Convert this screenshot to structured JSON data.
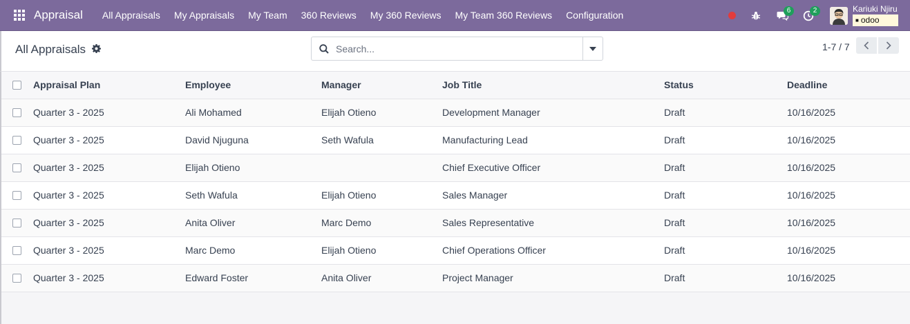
{
  "navbar": {
    "app_name": "Appraisal",
    "menu": [
      "All Appraisals",
      "My Appraisals",
      "My Team",
      "360 Reviews",
      "My 360 Reviews",
      "My Team 360 Reviews",
      "Configuration"
    ],
    "messages_count": "6",
    "activities_count": "2",
    "user_name": "Kariuki Njiru",
    "database": "odoo",
    "accent_color": "#7c6a9c"
  },
  "control_panel": {
    "title": "All Appraisals",
    "search_placeholder": "Search...",
    "pager": "1-7 / 7"
  },
  "table": {
    "columns": [
      "Appraisal Plan",
      "Employee",
      "Manager",
      "Job Title",
      "Status",
      "Deadline"
    ],
    "rows": [
      [
        "Quarter 3 - 2025",
        "Ali Mohamed",
        "Elijah Otieno",
        "Development Manager",
        "Draft",
        "10/16/2025"
      ],
      [
        "Quarter 3 - 2025",
        "David Njuguna",
        "Seth Wafula",
        "Manufacturing Lead",
        "Draft",
        "10/16/2025"
      ],
      [
        "Quarter 3 - 2025",
        "Elijah Otieno",
        "",
        "Chief Executive Officer",
        "Draft",
        "10/16/2025"
      ],
      [
        "Quarter 3 - 2025",
        "Seth Wafula",
        "Elijah Otieno",
        "Sales Manager",
        "Draft",
        "10/16/2025"
      ],
      [
        "Quarter 3 - 2025",
        "Anita Oliver",
        "Marc Demo",
        "Sales Representative",
        "Draft",
        "10/16/2025"
      ],
      [
        "Quarter 3 - 2025",
        "Marc Demo",
        "Elijah Otieno",
        "Chief Operations Officer",
        "Draft",
        "10/16/2025"
      ],
      [
        "Quarter 3 - 2025",
        "Edward Foster",
        "Anita Oliver",
        "Project Manager",
        "Draft",
        "10/16/2025"
      ]
    ]
  }
}
